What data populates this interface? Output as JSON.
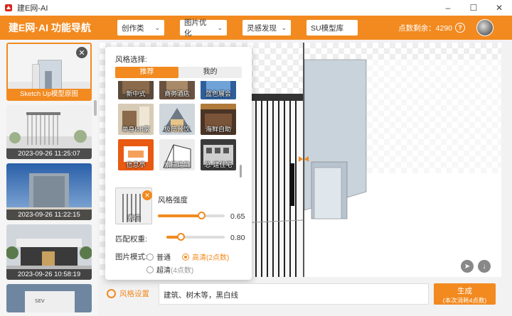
{
  "window": {
    "title": "建E网-AI"
  },
  "header": {
    "brand": "建E网·AI 功能导航",
    "nav": [
      {
        "label": "创作类"
      },
      {
        "label": "图片优化"
      },
      {
        "label": "灵感发现"
      },
      {
        "label": "SU模型库"
      }
    ],
    "points_label": "点数剩余：4290",
    "help": "?"
  },
  "sidebar": {
    "items": [
      {
        "caption": "Sketch Up模型原图"
      },
      {
        "caption": "2023-09-26 11:25:07"
      },
      {
        "caption": "2023-09-26 11:22:15"
      },
      {
        "caption": "2023-09-26 10:58:19"
      },
      {
        "caption": ""
      }
    ]
  },
  "style_panel": {
    "title": "风格选择:",
    "tabs": [
      {
        "label": "推荐"
      },
      {
        "label": "我的"
      }
    ],
    "tiles": [
      {
        "label": "新中式"
      },
      {
        "label": "商务酒店"
      },
      {
        "label": "蓝色展会"
      },
      {
        "label": "单身loft家"
      },
      {
        "label": "极简餐饮"
      },
      {
        "label": "海鲜自助"
      },
      {
        "label": "信息亭"
      },
      {
        "label": "素描建筑"
      },
      {
        "label": "总·建住宅"
      }
    ],
    "selected_style": "素描",
    "strength_label": "风格强度",
    "strength_value": "0.65",
    "match_label": "匹配权重:",
    "match_value": "0.80",
    "mode_label": "图片模式:",
    "modes": [
      {
        "label": "普通",
        "sub": ""
      },
      {
        "label": "高清",
        "sub": "(2点数)"
      },
      {
        "label": "超清",
        "sub": "(4点数)"
      }
    ]
  },
  "bottom": {
    "style_settings": "风格设置",
    "prompt": "建筑、树木等，黑白线",
    "generate": "生成",
    "generate_sub": "(本次消耗4点数)"
  }
}
